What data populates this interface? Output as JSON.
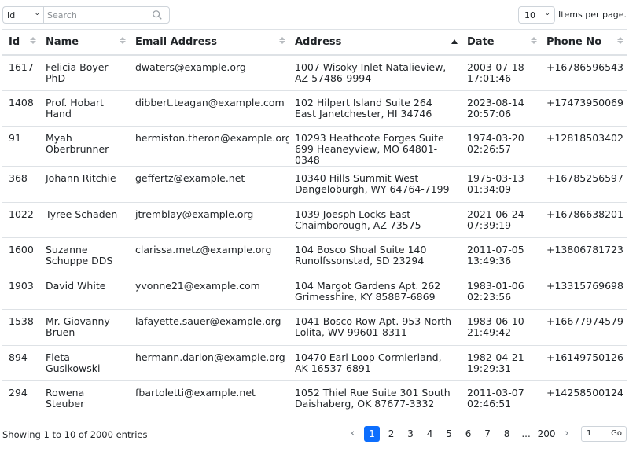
{
  "toolbar": {
    "column_select": "Id",
    "search_placeholder": "Search",
    "per_page_value": "10",
    "per_page_label": "Items per page."
  },
  "columns": [
    "Id",
    "Name",
    "Email Address",
    "Address",
    "Date",
    "Phone No"
  ],
  "sort": {
    "column": "Address",
    "direction": "asc"
  },
  "rows": [
    {
      "id": "1617",
      "name": "Felicia Boyer PhD",
      "email": "dwaters@example.org",
      "address": "1007 Wisoky Inlet Natalieview, AZ 57486-9994",
      "date": "2003-07-18 17:01:46",
      "phone": "+16786596543"
    },
    {
      "id": "1408",
      "name": "Prof. Hobart Hand",
      "email": "dibbert.teagan@example.com",
      "address": "102 Hilpert Island Suite 264 East Janetchester, HI 34746",
      "date": "2023-08-14 20:57:06",
      "phone": "+17473950069"
    },
    {
      "id": "91",
      "name": "Myah Oberbrunner",
      "email": "hermiston.theron@example.org",
      "address": "10293 Heathcote Forges Suite 699 Heaneyview, MO 64801-0348",
      "date": "1974-03-20 02:26:57",
      "phone": "+12818503402"
    },
    {
      "id": "368",
      "name": "Johann Ritchie",
      "email": "geffertz@example.net",
      "address": "10340 Hills Summit West Dangeloburgh, WY 64764-7199",
      "date": "1975-03-13 01:34:09",
      "phone": "+16785256597"
    },
    {
      "id": "1022",
      "name": "Tyree Schaden",
      "email": "jtremblay@example.org",
      "address": "1039 Joesph Locks East Chaimborough, AZ 73575",
      "date": "2021-06-24 07:39:19",
      "phone": "+16786638201"
    },
    {
      "id": "1600",
      "name": "Suzanne Schuppe DDS",
      "email": "clarissa.metz@example.org",
      "address": "104 Bosco Shoal Suite 140 Runolfssonstad, SD 23294",
      "date": "2011-07-05 13:49:36",
      "phone": "+13806781723"
    },
    {
      "id": "1903",
      "name": "David White",
      "email": "yvonne21@example.com",
      "address": "104 Margot Gardens Apt. 262 Grimesshire, KY 85887-6869",
      "date": "1983-01-06 02:23:56",
      "phone": "+13315769698"
    },
    {
      "id": "1538",
      "name": "Mr. Giovanny Bruen",
      "email": "lafayette.sauer@example.org",
      "address": "1041 Bosco Row Apt. 953 North Lolita, WV 99601-8311",
      "date": "1983-06-10 21:49:42",
      "phone": "+16677974579"
    },
    {
      "id": "894",
      "name": "Fleta Gusikowski",
      "email": "hermann.darion@example.org",
      "address": "10470 Earl Loop Cormierland, AK 16537-6891",
      "date": "1982-04-21 19:29:31",
      "phone": "+16149750126"
    },
    {
      "id": "294",
      "name": "Rowena Steuber",
      "email": "fbartoletti@example.net",
      "address": "1052 Thiel Rue Suite 301 South Daishaberg, OK 87677-3332",
      "date": "2011-03-07 02:46:51",
      "phone": "+14258500124"
    }
  ],
  "footer": {
    "info": "Showing 1 to 10 of 2000 entries",
    "prev_icon": "chevron-left-icon",
    "next_icon": "chevron-right-icon",
    "pages": [
      "1",
      "2",
      "3",
      "4",
      "5",
      "6",
      "7",
      "8",
      "...",
      "200"
    ],
    "active_page": "1",
    "goto_value": "1",
    "goto_label": "Go"
  },
  "colors": {
    "accent": "#0d6efd",
    "border": "#dee2e6"
  }
}
